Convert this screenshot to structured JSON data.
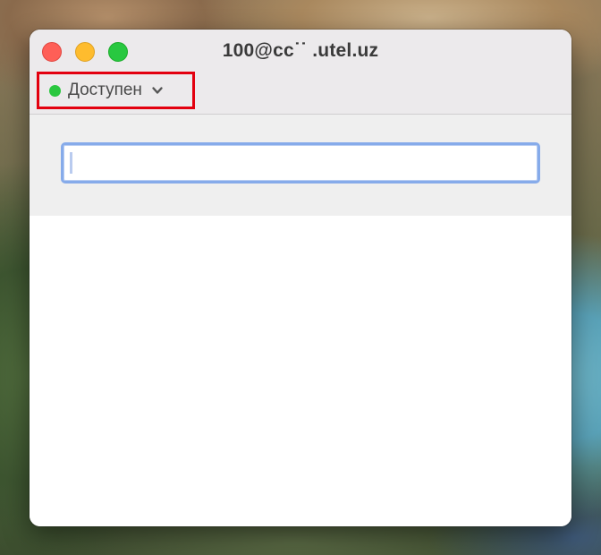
{
  "window": {
    "title": "100@cc˙˙ .utel.uz"
  },
  "status": {
    "label": "Доступен",
    "color": "#2ac73f",
    "dropdown_icon": "chevron-down-icon",
    "highlight_color": "#e3000f"
  },
  "search": {
    "value": "",
    "placeholder": ""
  }
}
